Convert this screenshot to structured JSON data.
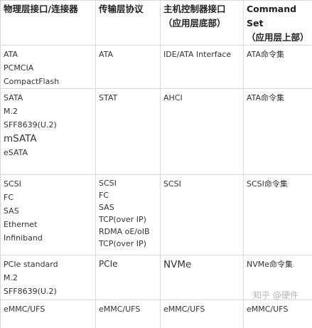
{
  "headers": {
    "col1": "物理层接口/连接器",
    "col2": "传输层协议",
    "col3_line1": "主机控制器接口",
    "col3_line2": "（应用层底部）",
    "col4_line1": "Command Set",
    "col4_line2": "（应用层上部）"
  },
  "rows": [
    {
      "physical": [
        "ATA",
        "PCMCIA",
        "CompactFlash"
      ],
      "transport": [
        "ATA"
      ],
      "controller": [
        "IDE/ATA Interface"
      ],
      "command": [
        "ATA命令集"
      ]
    },
    {
      "physical": [
        "SATA",
        "M.2",
        "SFF8639(U.2)",
        "mSATA",
        "eSATA"
      ],
      "transport": [
        "STAT"
      ],
      "controller": [
        "AHCI"
      ],
      "command": [
        "ATA命令集"
      ]
    },
    {
      "physical": [
        "SCSI",
        "FC",
        "SAS",
        "Ethernet",
        "Infiniband"
      ],
      "transport": [
        "SCSI",
        "FC",
        "SAS",
        "TCP(over  IP)",
        "RDMA oE/oIB",
        "TCP(over  IP)"
      ],
      "controller": [
        "SCSI"
      ],
      "command": [
        "SCSI命令集"
      ]
    },
    {
      "physical": [
        "PCIe standard",
        "M.2",
        "SFF8639(U.2)"
      ],
      "transport": [
        "PCIe"
      ],
      "controller": [
        "NVMe"
      ],
      "command": [
        "NVMe命令集"
      ]
    },
    {
      "physical": [
        "eMMC/UFS"
      ],
      "transport": [
        "eMMC/UFS"
      ],
      "controller": [
        "eMMC/UFS"
      ],
      "command": [
        "eMMC/UFS"
      ]
    }
  ],
  "watermark": "知乎 @硬件"
}
